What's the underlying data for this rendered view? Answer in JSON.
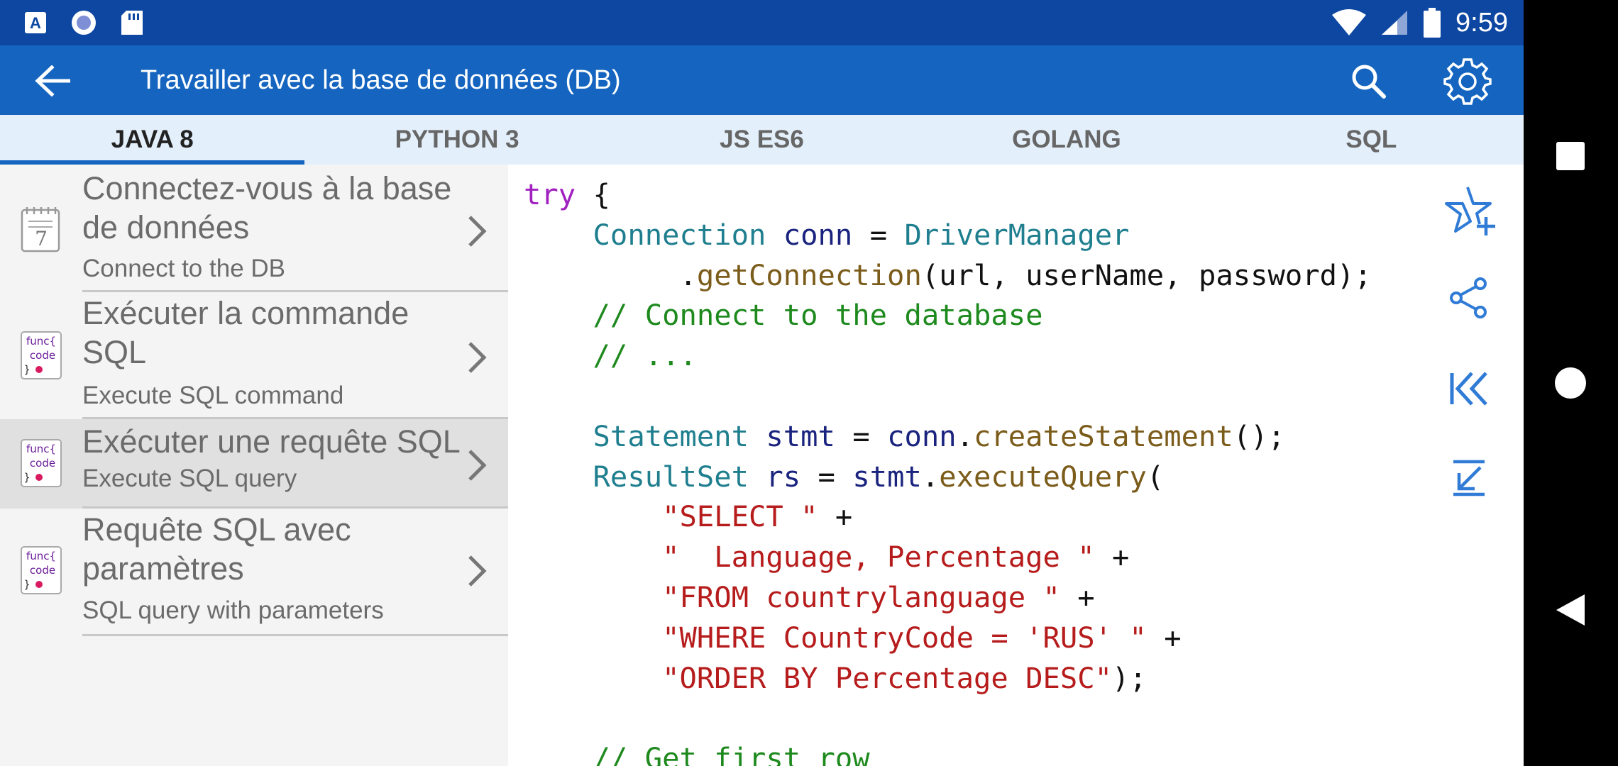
{
  "status_bar": {
    "time": "9:59",
    "left_icons": [
      "accessibility-app-icon",
      "record-icon",
      "sd-card-icon"
    ],
    "right_icons": [
      "wifi-icon",
      "signal-icon",
      "battery-icon"
    ]
  },
  "app_bar": {
    "title": "Travailler avec la base de données (DB)",
    "back_icon": "arrow-left-icon",
    "search_icon": "search-icon",
    "settings_icon": "gear-icon"
  },
  "tabs": [
    {
      "label": "JAVA 8",
      "active": true
    },
    {
      "label": "PYTHON 3",
      "active": false
    },
    {
      "label": "JS ES6",
      "active": false
    },
    {
      "label": "GOLANG",
      "active": false
    },
    {
      "label": "SQL",
      "active": false
    }
  ],
  "list": [
    {
      "title_lines": [
        "Connectez-vous à la base",
        "de données"
      ],
      "subtitle": "Connect to the DB",
      "icon": "notepad-icon",
      "selected": false
    },
    {
      "title_lines": [
        "Exécuter la commande",
        "SQL"
      ],
      "subtitle": "Execute SQL command",
      "icon": "func-code-icon",
      "icon_text": [
        "func{",
        "code",
        "}"
      ],
      "selected": false
    },
    {
      "title_lines": [
        "Exécuter une requête SQL"
      ],
      "subtitle": "Execute SQL query",
      "icon": "func-code-icon",
      "icon_text": [
        "func{",
        "code",
        "}"
      ],
      "selected": true
    },
    {
      "title_lines": [
        "Requête SQL avec",
        "paramètres"
      ],
      "subtitle": "SQL query with parameters",
      "icon": "func-code-icon",
      "icon_text": [
        "func{",
        "code",
        "}"
      ],
      "selected": false
    }
  ],
  "code": {
    "lines": [
      [
        [
          "kw",
          "try"
        ],
        [
          "pl",
          " {"
        ]
      ],
      [
        [
          "pl",
          "    "
        ],
        [
          "ty",
          "Connection"
        ],
        [
          "pl",
          " "
        ],
        [
          "vr",
          "conn"
        ],
        [
          "pl",
          " = "
        ],
        [
          "ty",
          "DriverManager"
        ]
      ],
      [
        [
          "pl",
          "         ."
        ],
        [
          "fn",
          "getConnection"
        ],
        [
          "pl",
          "(url, userName, password);"
        ]
      ],
      [
        [
          "pl",
          "    "
        ],
        [
          "cm",
          "// Connect to the database"
        ]
      ],
      [
        [
          "pl",
          "    "
        ],
        [
          "cm",
          "// ..."
        ]
      ],
      [
        [
          "pl",
          ""
        ]
      ],
      [
        [
          "pl",
          "    "
        ],
        [
          "ty",
          "Statement"
        ],
        [
          "pl",
          " "
        ],
        [
          "vr",
          "stmt"
        ],
        [
          "pl",
          " = "
        ],
        [
          "vr",
          "conn"
        ],
        [
          "pl",
          "."
        ],
        [
          "fn",
          "createStatement"
        ],
        [
          "pl",
          "();"
        ]
      ],
      [
        [
          "pl",
          "    "
        ],
        [
          "ty",
          "ResultSet"
        ],
        [
          "pl",
          " "
        ],
        [
          "vr",
          "rs"
        ],
        [
          "pl",
          " = "
        ],
        [
          "vr",
          "stmt"
        ],
        [
          "pl",
          "."
        ],
        [
          "fn",
          "executeQuery"
        ],
        [
          "pl",
          "("
        ]
      ],
      [
        [
          "pl",
          "        "
        ],
        [
          "st",
          "\"SELECT \""
        ],
        [
          "pl",
          " +"
        ]
      ],
      [
        [
          "pl",
          "        "
        ],
        [
          "st",
          "\"  Language, Percentage \""
        ],
        [
          "pl",
          " +"
        ]
      ],
      [
        [
          "pl",
          "        "
        ],
        [
          "st",
          "\"FROM countrylanguage \""
        ],
        [
          "pl",
          " +"
        ]
      ],
      [
        [
          "pl",
          "        "
        ],
        [
          "st",
          "\"WHERE CountryCode = 'RUS' \""
        ],
        [
          "pl",
          " +"
        ]
      ],
      [
        [
          "pl",
          "        "
        ],
        [
          "st",
          "\"ORDER BY Percentage DESC\""
        ],
        [
          "pl",
          ");"
        ]
      ],
      [
        [
          "pl",
          ""
        ]
      ],
      [
        [
          "pl",
          "    "
        ],
        [
          "cm",
          "// Get first row"
        ]
      ]
    ]
  },
  "side_actions": [
    "star-add-icon",
    "share-icon",
    "skip-first-icon",
    "collapse-icon"
  ],
  "nav_bar": [
    "square-recents-icon",
    "circle-home-icon",
    "triangle-back-icon"
  ],
  "colors": {
    "status_bar": "#0d47a1",
    "app_bar": "#1565c0",
    "tab_bar": "#e3effb",
    "accent": "#1565c0",
    "keyword": "#a020c0",
    "type": "#1f7f8f",
    "comment": "#1e8a1e",
    "string": "#b71c1c",
    "icon_blue": "#2f7bd6"
  }
}
